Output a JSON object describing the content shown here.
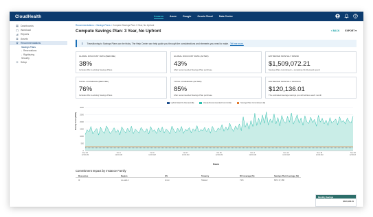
{
  "app": {
    "brand": "CloudHealth"
  },
  "cloud_tabs": [
    {
      "label": "Amazon",
      "active": true
    },
    {
      "label": "Azure",
      "active": false
    },
    {
      "label": "Google",
      "active": false
    },
    {
      "label": "Oracle Cloud",
      "active": false
    },
    {
      "label": "Data Center",
      "active": false
    }
  ],
  "sidebar": {
    "items": [
      {
        "label": "Dashboards"
      },
      {
        "label": "Workload"
      },
      {
        "label": "Reports"
      },
      {
        "label": "Assets"
      },
      {
        "label": "Recommendations"
      },
      {
        "label": "Savings Plans"
      },
      {
        "label": "Reservations"
      },
      {
        "label": "Rightsizing"
      },
      {
        "label": "Security"
      },
      {
        "label": "Setup"
      }
    ]
  },
  "header": {
    "breadcrumb_links": "Recommendations > Savings Plans >",
    "breadcrumb_current": "Compute Savings Plan: 3 Year, No Upfront",
    "title": "Compute Savings Plan: 3 Year, No Upfront",
    "back_label": "< BACK",
    "export_label": "EXPORT ▾"
  },
  "banner": {
    "text": "Transitioning to Savings Plans can be tricky. The Help Center can help guide you through the considerations and elements you need to make.",
    "link": "Tell me more."
  },
  "cards": [
    {
      "label": "Global Discount Rate (Before)",
      "value": "38%",
      "sub": "Includes RIs & existing Savings Plans"
    },
    {
      "label": "Global Discount Rate (After)",
      "value": "43%",
      "sub": "After recommended Savings Plan purchase"
    },
    {
      "label": "Estimated Monthly Spend",
      "value": "$1,509,072.21",
      "sub": "Savings Plan commitment + remaining On-Demand spend"
    },
    {
      "label": "Total Coverage (Before)",
      "value": "76%",
      "sub": "Includes RIs & existing Savings Plans"
    },
    {
      "label": "Total Coverage (After)",
      "value": "85%",
      "sub": "After recommended Savings Plan purchase"
    },
    {
      "label": "Estimated Monthly Savings",
      "value": "$120,136.01",
      "sub": "The estimated average savings you will achieve each month"
    }
  ],
  "chart_data": {
    "type": "area",
    "xlabel": "Hours",
    "ylabel": "Hourly Cost (USD)",
    "ylim": [
      0,
      3000
    ],
    "yticks": [
      "0",
      "500",
      "1000",
      "1500",
      "2000",
      "2500",
      "3000"
    ],
    "xticks": [
      "Dec 25\n12:00 AM",
      "Oct 1\n12:00 AM",
      "Oct 9\n12:00 AM",
      "Oct 17\n12:00 AM",
      "Oct 25\n12:00 AM",
      "Nov 2\n12:00 AM",
      "Nov 10\n12:00 AM",
      "Nov 18\n12:00 AM",
      "Nov 26\n12:00 AM"
    ],
    "legend": [
      {
        "name": "Hybrid Ideal On-Demand ($)",
        "color": "#1f4e8c"
      },
      {
        "name": "Hourly Recommended Commit ($)",
        "color": "#2fbfae"
      },
      {
        "name": "Savings Plan Commitment ($)",
        "color": "#e07a2e"
      }
    ],
    "commitment_level": 250,
    "series": [
      {
        "name": "Hourly Recommended Commit ($)",
        "values": [
          1120,
          1450,
          1300,
          1680,
          1150,
          1380,
          1540,
          1090,
          1620,
          1340,
          1210,
          1720,
          1480,
          1180,
          1360,
          1590,
          1270,
          1450,
          1100,
          1650,
          1410,
          1230,
          1560,
          1320,
          1700,
          1180,
          1490,
          1360,
          1220,
          1610,
          1400,
          1280,
          1530,
          1150,
          1670,
          1340,
          1450,
          1190,
          1580,
          1300,
          1640,
          1230,
          1490,
          1380,
          1160,
          1710,
          1420,
          1250,
          1560,
          1330,
          1680,
          1200,
          1470,
          1390,
          1600,
          1240,
          1520,
          1360,
          1740,
          1290,
          1460,
          1380,
          1620,
          1310,
          1550,
          1220,
          1690,
          1400,
          1300,
          1580,
          1460,
          1810,
          1350,
          1640,
          1420,
          1900,
          1550,
          1330,
          1720,
          1480,
          1860,
          1390,
          2350,
          1620,
          1950,
          1500,
          2100,
          1680,
          2600,
          1750,
          2250,
          1820,
          2480,
          1900,
          2700,
          1780,
          2200,
          1950,
          2550,
          1860,
          2300,
          1720,
          2450,
          2050,
          1900,
          2380,
          1980,
          2620,
          1850,
          2150,
          2500,
          1920,
          2280,
          1760,
          2420,
          2010,
          1880,
          2330,
          1950,
          2180,
          1700,
          2450,
          1980,
          2250,
          1860,
          2120,
          1750,
          2300,
          1900,
          2050,
          2200,
          1800,
          2350,
          1980,
          2100,
          1850,
          2270,
          2000,
          1920,
          2400
        ]
      }
    ]
  },
  "commitment_table": {
    "title": "Commitment Impact by Instance Family",
    "columns": [
      "Resources",
      "Region",
      "OS",
      "Tenancy",
      "RI Coverage (%)",
      "Savings Plan Coverage (%)"
    ],
    "rows": [
      [
        "t2",
        "us-east-1",
        "Linux",
        "Shared",
        "71%",
        "82%   17,180"
      ]
    ]
  },
  "side_panel": {
    "title": "Monthly Savings",
    "value": "$120,136.01"
  }
}
